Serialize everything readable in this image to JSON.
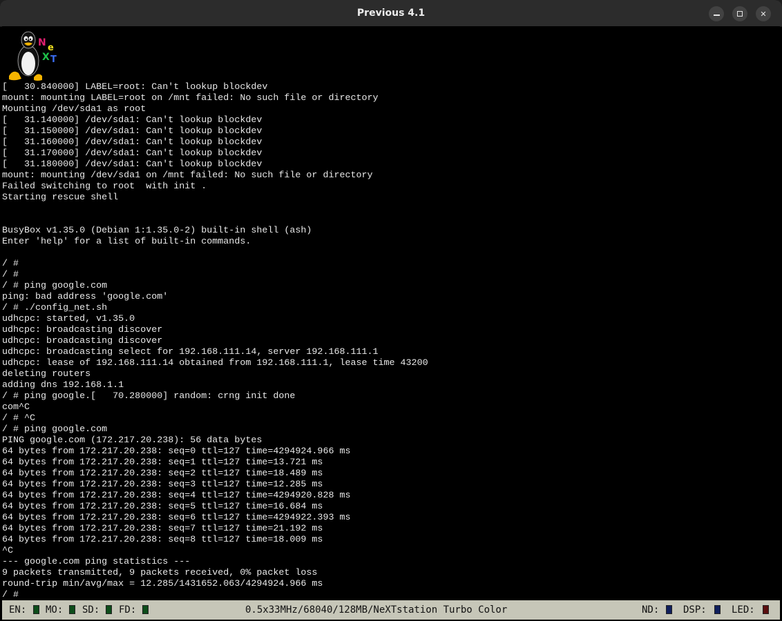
{
  "window": {
    "title": "Previous 4.1",
    "minimize_label": "–",
    "maximize_label": "□",
    "close_label": "✕"
  },
  "logo": {
    "icon": "tux-next-logo",
    "text": "NeXT"
  },
  "terminal": {
    "lines": [
      "[   30.840000] LABEL=root: Can't lookup blockdev",
      "mount: mounting LABEL=root on /mnt failed: No such file or directory",
      "Mounting /dev/sda1 as root",
      "[   31.140000] /dev/sda1: Can't lookup blockdev",
      "[   31.150000] /dev/sda1: Can't lookup blockdev",
      "[   31.160000] /dev/sda1: Can't lookup blockdev",
      "[   31.170000] /dev/sda1: Can't lookup blockdev",
      "[   31.180000] /dev/sda1: Can't lookup blockdev",
      "mount: mounting /dev/sda1 on /mnt failed: No such file or directory",
      "Failed switching to root  with init .",
      "Starting rescue shell",
      "",
      "",
      "BusyBox v1.35.0 (Debian 1:1.35.0-2) built-in shell (ash)",
      "Enter 'help' for a list of built-in commands.",
      "",
      "/ #",
      "/ #",
      "/ # ping google.com",
      "ping: bad address 'google.com'",
      "/ # ./config_net.sh",
      "udhcpc: started, v1.35.0",
      "udhcpc: broadcasting discover",
      "udhcpc: broadcasting discover",
      "udhcpc: broadcasting select for 192.168.111.14, server 192.168.111.1",
      "udhcpc: lease of 192.168.111.14 obtained from 192.168.111.1, lease time 43200",
      "deleting routers",
      "adding dns 192.168.1.1",
      "/ # ping google.[   70.280000] random: crng init done",
      "com^C",
      "/ # ^C",
      "/ # ping google.com",
      "PING google.com (172.217.20.238): 56 data bytes",
      "64 bytes from 172.217.20.238: seq=0 ttl=127 time=4294924.966 ms",
      "64 bytes from 172.217.20.238: seq=1 ttl=127 time=13.721 ms",
      "64 bytes from 172.217.20.238: seq=2 ttl=127 time=18.489 ms",
      "64 bytes from 172.217.20.238: seq=3 ttl=127 time=12.285 ms",
      "64 bytes from 172.217.20.238: seq=4 ttl=127 time=4294920.828 ms",
      "64 bytes from 172.217.20.238: seq=5 ttl=127 time=16.684 ms",
      "64 bytes from 172.217.20.238: seq=6 ttl=127 time=4294922.393 ms",
      "64 bytes from 172.217.20.238: seq=7 ttl=127 time=21.192 ms",
      "64 bytes from 172.217.20.238: seq=8 ttl=127 time=18.009 ms",
      "^C",
      "--- google.com ping statistics ---",
      "9 packets transmitted, 9 packets received, 0% packet loss",
      "round-trip min/avg/max = 12.285/1431652.063/4294924.966 ms",
      "/ #"
    ]
  },
  "statusbar": {
    "en_label": "EN:",
    "mo_label": "MO:",
    "sd_label": "SD:",
    "fd_label": "FD:",
    "machine_info": "0.5x33MHz/68040/128MB/NeXTstation Turbo Color",
    "nd_label": "ND:",
    "dsp_label": "DSP:",
    "led_label": "LED:",
    "colors": {
      "green": "#0d4d1a",
      "blue": "#0f1f5c",
      "red": "#5a0f0f"
    }
  }
}
